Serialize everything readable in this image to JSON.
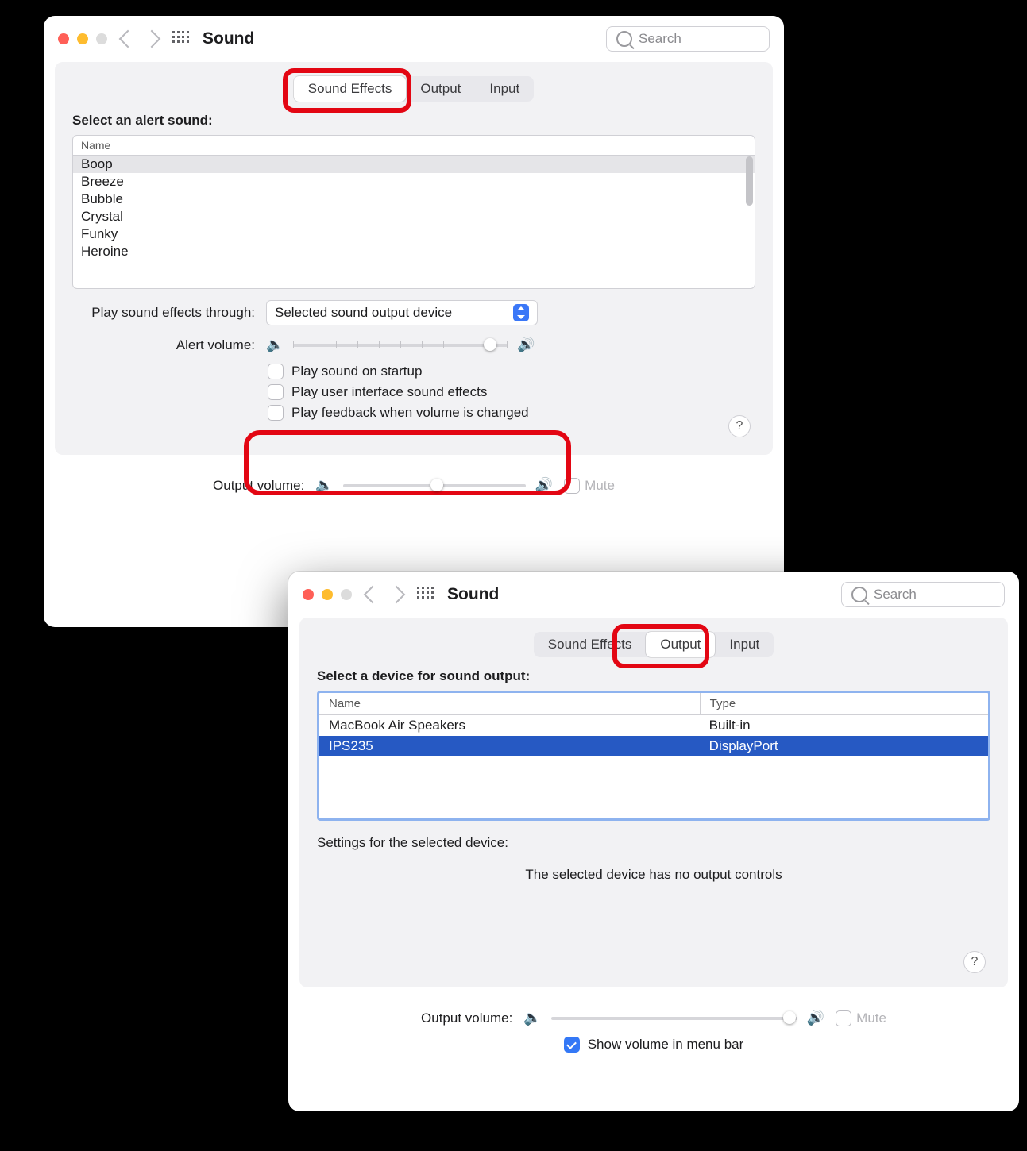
{
  "window1": {
    "title": "Sound",
    "search_placeholder": "Search",
    "tabs": {
      "sound_effects": "Sound Effects",
      "output": "Output",
      "input": "Input"
    },
    "select_alert_label": "Select an alert sound:",
    "name_header": "Name",
    "alert_sounds": [
      "Boop",
      "Breeze",
      "Bubble",
      "Crystal",
      "Funky",
      "Heroine"
    ],
    "play_through_label": "Play sound effects through:",
    "play_through_value": "Selected sound output device",
    "alert_volume_label": "Alert volume:",
    "cb_startup": "Play sound on startup",
    "cb_ui_effects": "Play user interface sound effects",
    "cb_feedback": "Play feedback when volume is changed",
    "output_volume_label": "Output volume:",
    "mute_label": "Mute",
    "help": "?"
  },
  "window2": {
    "title": "Sound",
    "search_placeholder": "Search",
    "tabs": {
      "sound_effects": "Sound Effects",
      "output": "Output",
      "input": "Input"
    },
    "select_device_label": "Select a device for sound output:",
    "col_name": "Name",
    "col_type": "Type",
    "devices": [
      {
        "name": "MacBook Air Speakers",
        "type": "Built-in"
      },
      {
        "name": "IPS235",
        "type": "DisplayPort"
      }
    ],
    "settings_label": "Settings for the selected device:",
    "no_controls": "The selected device has no output controls",
    "output_volume_label": "Output volume:",
    "mute_label": "Mute",
    "show_menu": "Show volume in menu bar",
    "help": "?"
  }
}
